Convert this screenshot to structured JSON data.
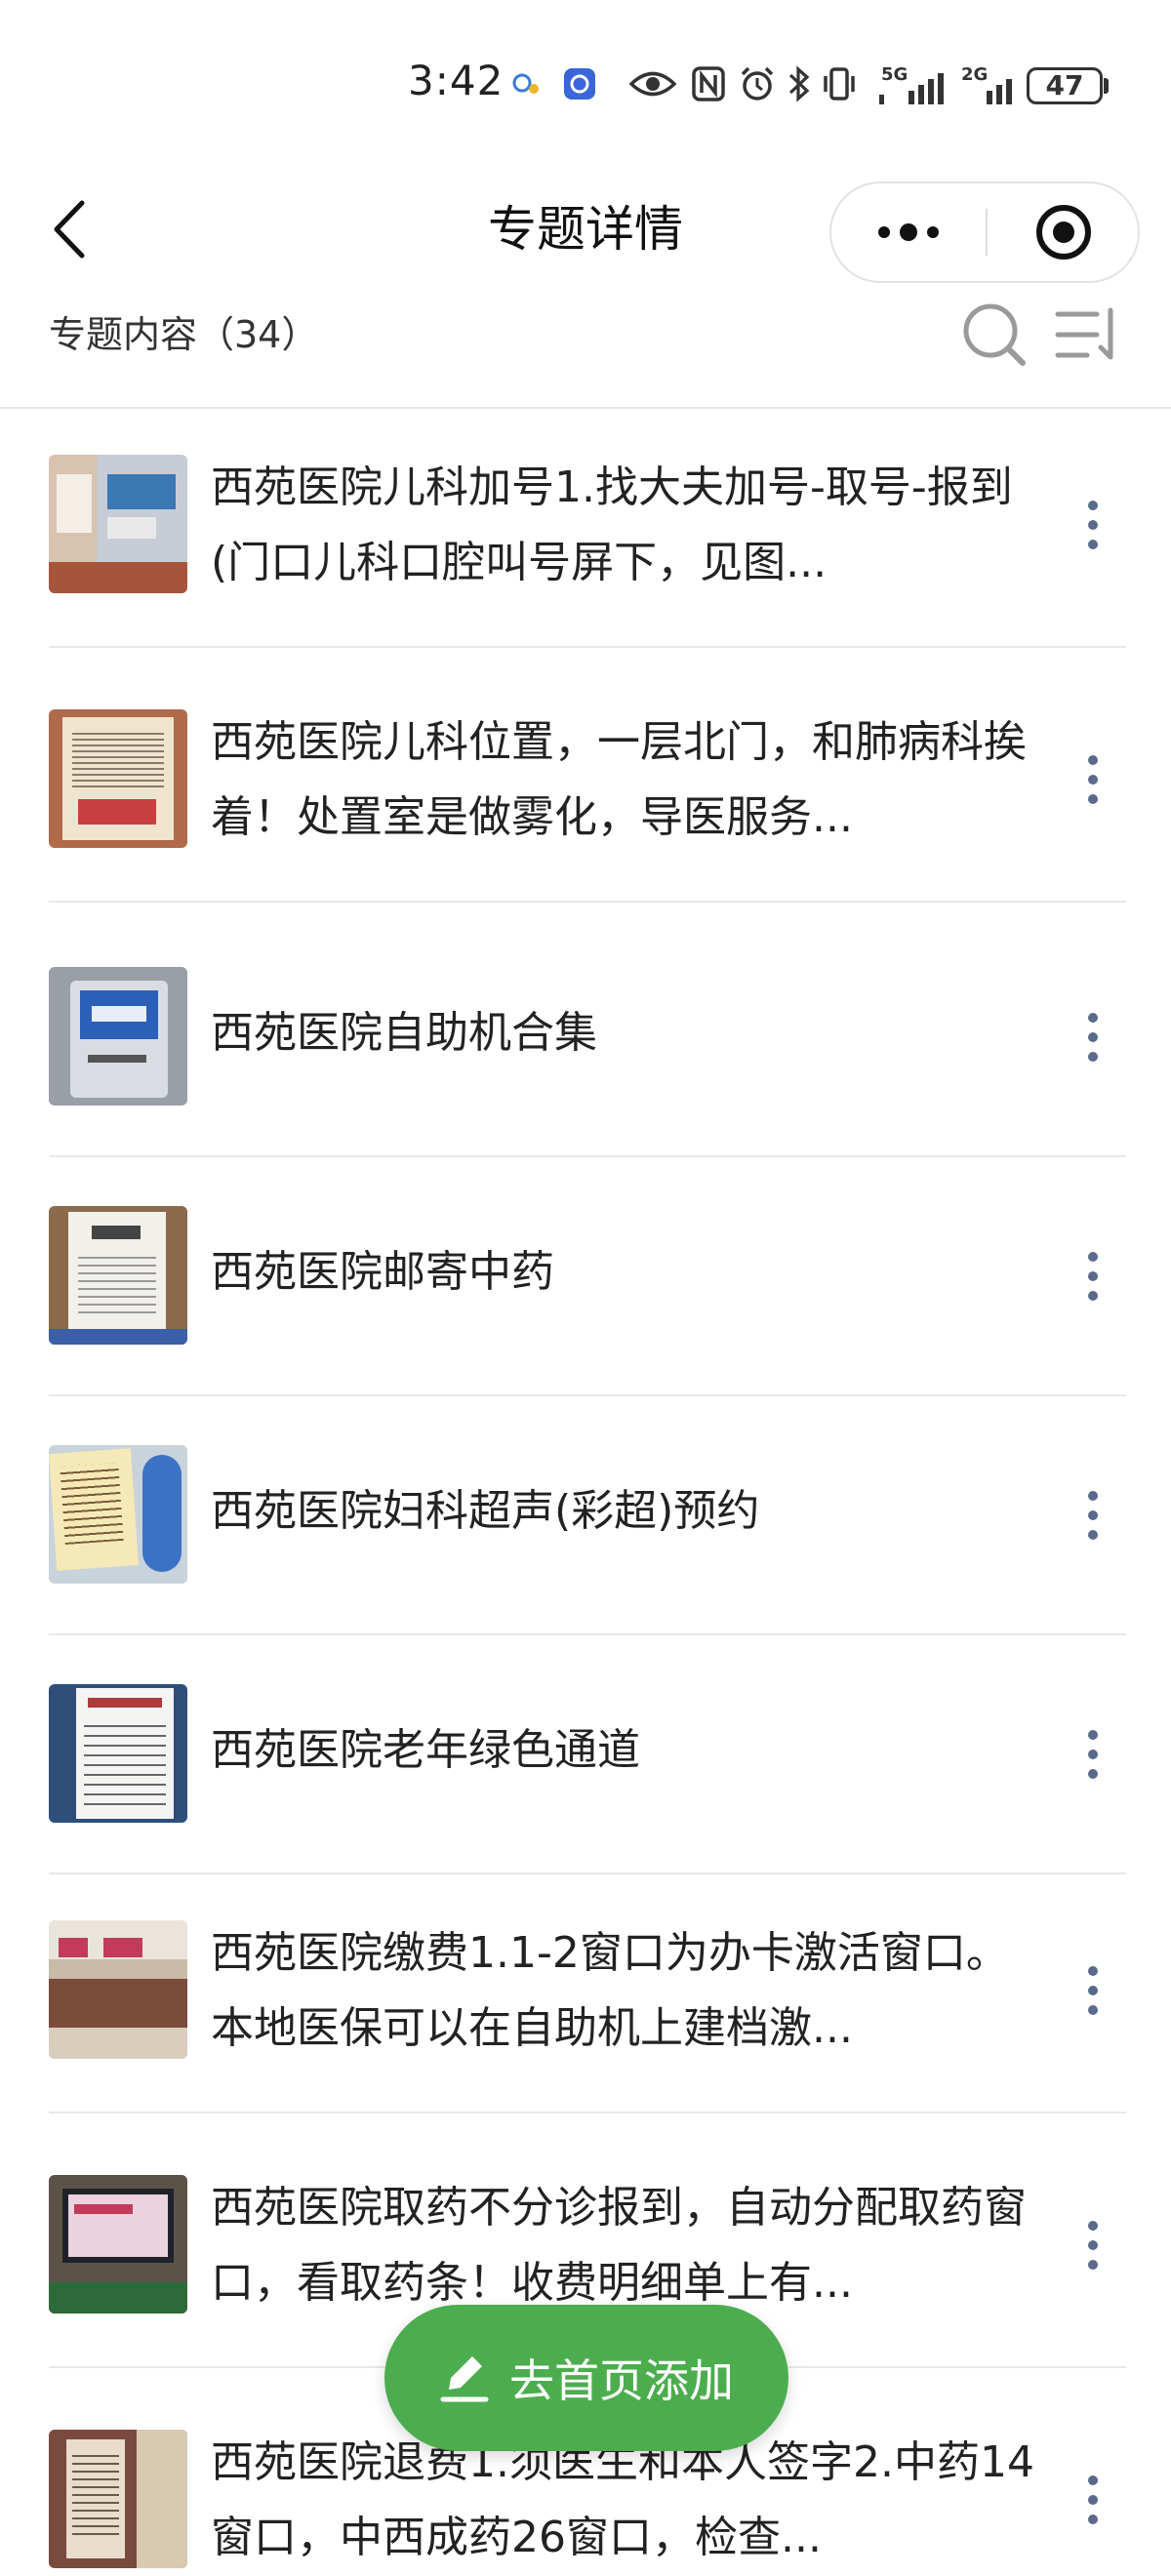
{
  "status_bar": {
    "time": "3:42",
    "network_5g": "5G",
    "network_2g": "2G",
    "battery": "47"
  },
  "nav": {
    "title": "专题详情"
  },
  "section": {
    "title": "专题内容（34）"
  },
  "items": [
    {
      "title": "西苑医院儿科加号1.找大夫加号-取号-报到(门口儿科口腔叫号屏下，见图..."
    },
    {
      "title": "西苑医院儿科位置，一层北门，和肺病科挨着！处置室是做雾化，导医服务..."
    },
    {
      "title": "西苑医院自助机合集"
    },
    {
      "title": "西苑医院邮寄中药"
    },
    {
      "title": "西苑医院妇科超声(彩超)预约"
    },
    {
      "title": "西苑医院老年绿色通道"
    },
    {
      "title": "西苑医院缴费1.1-2窗口为办卡激活窗口。本地医保可以在自助机上建档激..."
    },
    {
      "title": "西苑医院取药不分诊报到，自动分配取药窗口，看取药条！收费明细单上有..."
    },
    {
      "title": "西苑医院退费1.须医生和本人签字2.中药14窗口，中西成药26窗口，检查..."
    }
  ],
  "fab": {
    "label": "去首页添加"
  }
}
